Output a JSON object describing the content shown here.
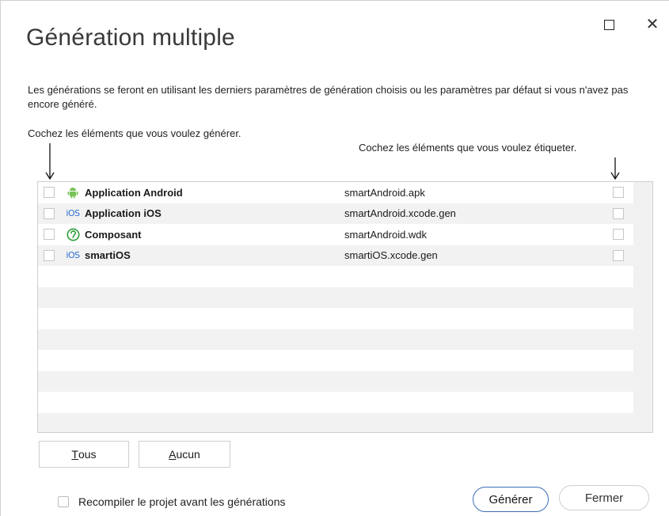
{
  "window": {
    "title": "Génération multiple",
    "maximize_icon": "maximize-icon",
    "close_icon": "close-icon",
    "close_glyph": "✕"
  },
  "description": "Les générations se feront en utilisant les derniers paramètres de génération choisis ou les paramètres par défaut si vous n'avez pas encore généré.",
  "hints": {
    "left": "Cochez les éléments que vous voulez générer.",
    "right": "Cochez les éléments que vous voulez étiqueter."
  },
  "items": [
    {
      "name": "Application Android",
      "file": "smartAndroid.apk",
      "icon": "android-icon",
      "generate_checked": false,
      "tag_checked": false
    },
    {
      "name": "Application iOS",
      "file": "smartAndroid.xcode.gen",
      "icon": "ios-icon",
      "generate_checked": false,
      "tag_checked": false
    },
    {
      "name": "Composant",
      "file": "smartAndroid.wdk",
      "icon": "component-icon",
      "generate_checked": false,
      "tag_checked": false
    },
    {
      "name": "smartiOS",
      "file": "smartiOS.xcode.gen",
      "icon": "ios-icon",
      "generate_checked": false,
      "tag_checked": false
    }
  ],
  "ios_badge": "iOS",
  "buttons": {
    "tous_first": "T",
    "tous_rest": "ous",
    "aucun_first": "A",
    "aucun_rest": "ucun",
    "generer": "Générer",
    "fermer": "Fermer"
  },
  "footer": {
    "recompile_label": "Recompiler le projet avant les générations",
    "recompile_checked": false
  },
  "colors": {
    "android_green": "#78c257",
    "ios_blue": "#2a6fd6",
    "component_green": "#2e9e3a",
    "primary_border": "#3a6fb5"
  }
}
